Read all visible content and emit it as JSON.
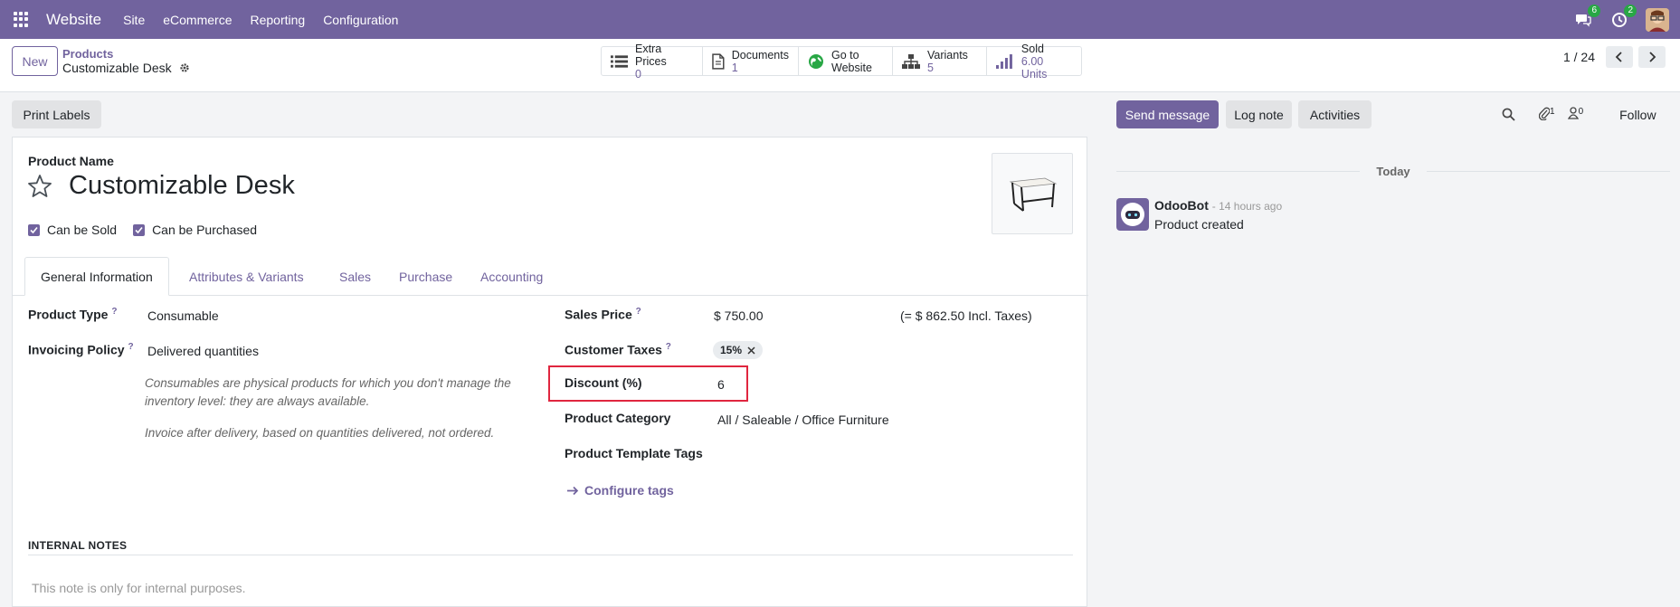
{
  "topnav": {
    "brand": "Website",
    "menu": [
      "Site",
      "eCommerce",
      "Reporting",
      "Configuration"
    ],
    "messages_badge": "6",
    "activities_badge": "2"
  },
  "control": {
    "new_label": "New",
    "breadcrumb_parent": "Products",
    "breadcrumb_current": "Customizable Desk",
    "smart_buttons": [
      {
        "label": "Extra Prices",
        "value": "0",
        "icon": "list-icon"
      },
      {
        "label": "Documents",
        "value": "1",
        "icon": "file-icon"
      },
      {
        "label": "Go to",
        "value": "Website",
        "icon": "globe-icon"
      },
      {
        "label": "Variants",
        "value": "5",
        "icon": "sitemap-icon"
      },
      {
        "label": "Sold",
        "value": "6.00 Units",
        "icon": "signal-icon"
      }
    ],
    "pager": "1 / 24"
  },
  "form": {
    "print_labels": "Print Labels",
    "product_name_label": "Product Name",
    "product_name": "Customizable Desk",
    "can_be_sold": "Can be Sold",
    "can_be_purchased": "Can be Purchased",
    "tabs": [
      "General Information",
      "Attributes & Variants",
      "Sales",
      "Purchase",
      "Accounting"
    ],
    "product_type_label": "Product Type",
    "product_type": "Consumable",
    "invoicing_policy_label": "Invoicing Policy",
    "invoicing_policy": "Delivered quantities",
    "help_consumable": "Consumables are physical products for which you don't manage the inventory level: they are always available.",
    "help_invoice": "Invoice after delivery, based on quantities delivered, not ordered.",
    "sales_price_label": "Sales Price",
    "sales_price": "$ 750.00",
    "sales_price_incl": "(= $ 862.50 Incl. Taxes)",
    "customer_taxes_label": "Customer Taxes",
    "customer_tax": "15%",
    "discount_label": "Discount (%)",
    "discount": "6",
    "product_category_label": "Product Category",
    "product_category": "All / Saleable / Office Furniture",
    "template_tags_label": "Product Template Tags",
    "configure_tags": "Configure tags",
    "internal_notes_title": "INTERNAL NOTES",
    "internal_notes_placeholder": "This note is only for internal purposes.",
    "help_marker": "?"
  },
  "chatter": {
    "send_message": "Send message",
    "log_note": "Log note",
    "activities": "Activities",
    "attachments_count": "1",
    "followers_count": "0",
    "follow": "Follow",
    "today": "Today",
    "author": "OdooBot",
    "time": "- 14 hours ago",
    "body": "Product created"
  }
}
